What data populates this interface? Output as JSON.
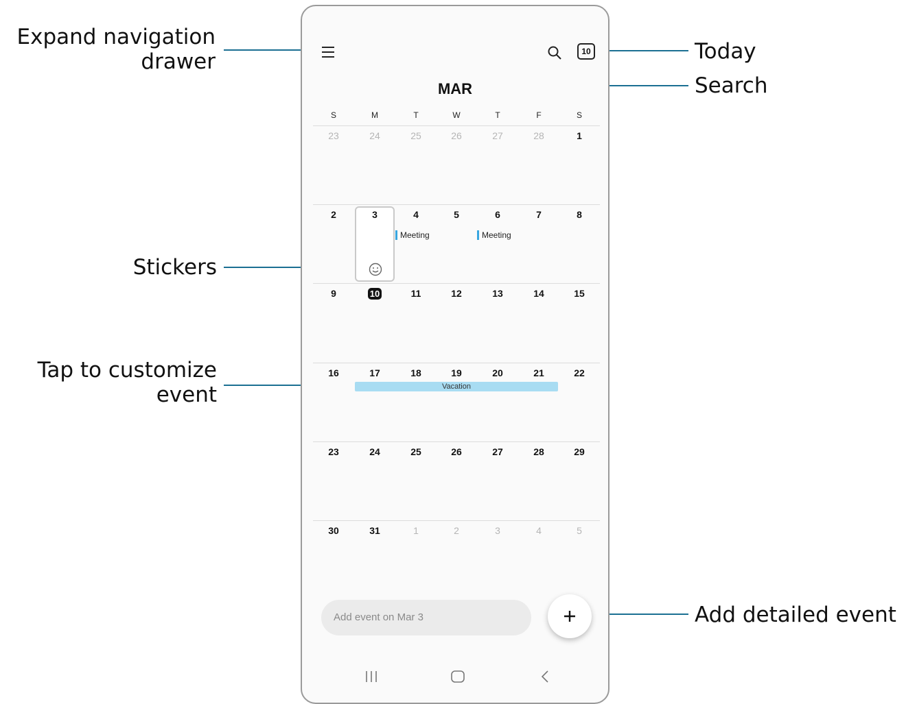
{
  "callouts": {
    "expand_nav_line1": "Expand navigation",
    "expand_nav_line2": "drawer",
    "today": "Today",
    "search": "Search",
    "stickers": "Stickers",
    "customize_line1": "Tap to customize",
    "customize_line2": "event",
    "add_detailed": "Add detailed event"
  },
  "calendar": {
    "month": "MAR",
    "today_badge": "10",
    "weekdays": [
      "S",
      "M",
      "T",
      "W",
      "T",
      "F",
      "S"
    ],
    "weeks": [
      [
        "23",
        "24",
        "25",
        "26",
        "27",
        "28",
        "1"
      ],
      [
        "2",
        "3",
        "4",
        "5",
        "6",
        "7",
        "8"
      ],
      [
        "9",
        "10",
        "11",
        "12",
        "13",
        "14",
        "15"
      ],
      [
        "16",
        "17",
        "18",
        "19",
        "20",
        "21",
        "22"
      ],
      [
        "23",
        "24",
        "25",
        "26",
        "27",
        "28",
        "29"
      ],
      [
        "30",
        "31",
        "1",
        "2",
        "3",
        "4",
        "5"
      ]
    ],
    "events": {
      "meeting_1": "Meeting",
      "meeting_2": "Meeting",
      "vacation": "Vacation"
    }
  },
  "add_event": {
    "placeholder": "Add event on Mar 3",
    "fab_label": "+"
  },
  "icons": [
    "menu-icon",
    "search-icon",
    "today-icon",
    "sticker-smiley-icon",
    "add-icon",
    "recents-icon",
    "home-icon",
    "back-icon"
  ],
  "colors": {
    "leader": "#1a6f92",
    "event_accent": "#38a6e0",
    "vacation_bar": "#a8dcf2",
    "today_fill": "#111111"
  }
}
